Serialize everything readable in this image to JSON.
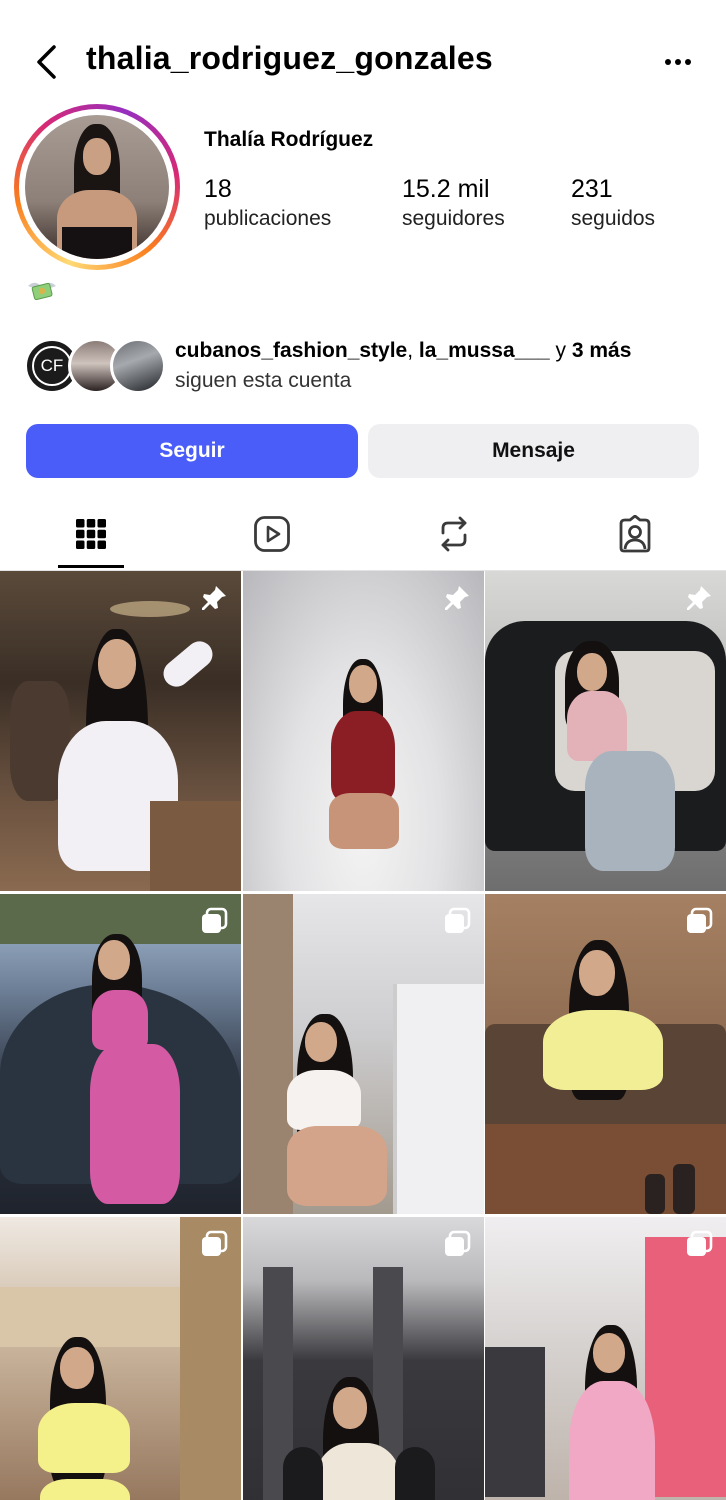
{
  "header": {
    "username": "thalia_rodriguez_gonzales"
  },
  "profile": {
    "display_name": "Thalía Rodríguez",
    "stats": [
      {
        "value": "18",
        "label": "publicaciones"
      },
      {
        "value": "15.2 mil",
        "label": "seguidores"
      },
      {
        "value": "231",
        "label": "seguidos"
      }
    ],
    "bio_emoji": "money-with-wings-icon"
  },
  "followed_by": {
    "first": "cubanos_fashion_style",
    "separator": ", ",
    "second": "la_mussa___",
    "connector": " y ",
    "more": "3 más",
    "subline": "siguen esta cuenta",
    "cf_logo_text": "CF"
  },
  "actions": {
    "follow_label": "Seguir",
    "message_label": "Mensaje",
    "follow_color": "#4a5df9"
  },
  "tabs": [
    {
      "name": "grid-icon",
      "active": true
    },
    {
      "name": "reels-icon",
      "active": false
    },
    {
      "name": "reposts-icon",
      "active": false
    },
    {
      "name": "tagged-icon",
      "active": false
    }
  ],
  "posts": [
    {
      "badge": "pin-icon",
      "scene": "restaurant, white zip-up outfit"
    },
    {
      "badge": "pin-icon",
      "scene": "studio, red corset"
    },
    {
      "badge": "pin-icon",
      "scene": "parking garage, black car"
    },
    {
      "badge": "carousel-icon",
      "scene": "parking lot, pink set"
    },
    {
      "badge": "carousel-icon",
      "scene": "kitchen mirror selfie"
    },
    {
      "badge": "carousel-icon",
      "scene": "cafe, yellow top"
    },
    {
      "badge": "carousel-icon",
      "scene": "store, yellow set"
    },
    {
      "badge": "carousel-icon",
      "scene": "fitting room mirror selfie"
    },
    {
      "badge": "carousel-icon",
      "scene": "mall, pink dress"
    }
  ]
}
